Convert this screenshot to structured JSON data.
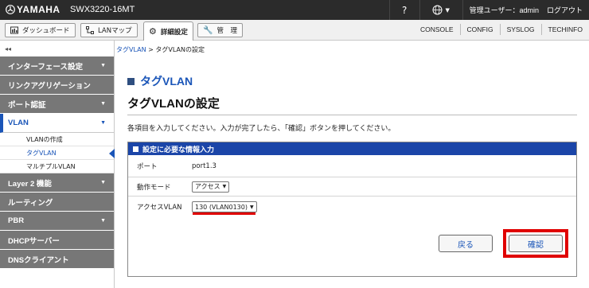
{
  "topbar": {
    "brand": "YAMAHA",
    "model": "SWX3220-16MT",
    "help": "?",
    "user_label": "管理ユーザー：admin",
    "logout": "ログアウト"
  },
  "tabs": [
    {
      "label": "ダッシュボード",
      "icon": "dashboard-icon"
    },
    {
      "label": "LANマップ",
      "icon": "lan-map-icon"
    },
    {
      "label": "詳細設定",
      "icon": "gear-icon"
    },
    {
      "label": "管　理",
      "icon": "wrench-icon"
    }
  ],
  "right_links": [
    "CONSOLE",
    "CONFIG",
    "SYSLOG",
    "TECHINFO"
  ],
  "sidebar": {
    "collapse": "◂◂",
    "items": [
      {
        "label": "インターフェース設定",
        "arrow": "▼"
      },
      {
        "label": "リンクアグリゲーション",
        "arrow": ""
      },
      {
        "label": "ポート認証",
        "arrow": "▼"
      },
      {
        "label": "VLAN",
        "arrow": "▼"
      },
      {
        "label": "Layer 2 機能",
        "arrow": "▼"
      },
      {
        "label": "ルーティング",
        "arrow": ""
      },
      {
        "label": "PBR",
        "arrow": "▼"
      },
      {
        "label": "DHCPサーバー",
        "arrow": ""
      },
      {
        "label": "DNSクライアント",
        "arrow": ""
      }
    ],
    "vlan_sub": [
      "VLANの作成",
      "タグVLAN",
      "マルチプルVLAN"
    ]
  },
  "breadcrumb": {
    "parent": "タグVLAN",
    "sep": ">",
    "current": "タグVLANの設定"
  },
  "page": {
    "heading": "タグVLAN",
    "title": "タグVLANの設定",
    "instruction": "各項目を入力してください。入力が完了したら、「確認」ボタンを押してください。"
  },
  "form": {
    "section_title": "設定に必要な情報入力",
    "port_label": "ポート",
    "port_value": "port1.3",
    "mode_label": "動作モード",
    "mode_value": "アクセス",
    "access_vlan_label": "アクセスVLAN",
    "access_vlan_value": "130 (VLAN0130)"
  },
  "buttons": {
    "back": "戻る",
    "confirm": "確認"
  },
  "colors": {
    "accent": "#1a55b8",
    "header": "#1b45a8",
    "highlight": "#e00000",
    "topbar": "#2b2b2b",
    "sidebar": "#777777"
  }
}
